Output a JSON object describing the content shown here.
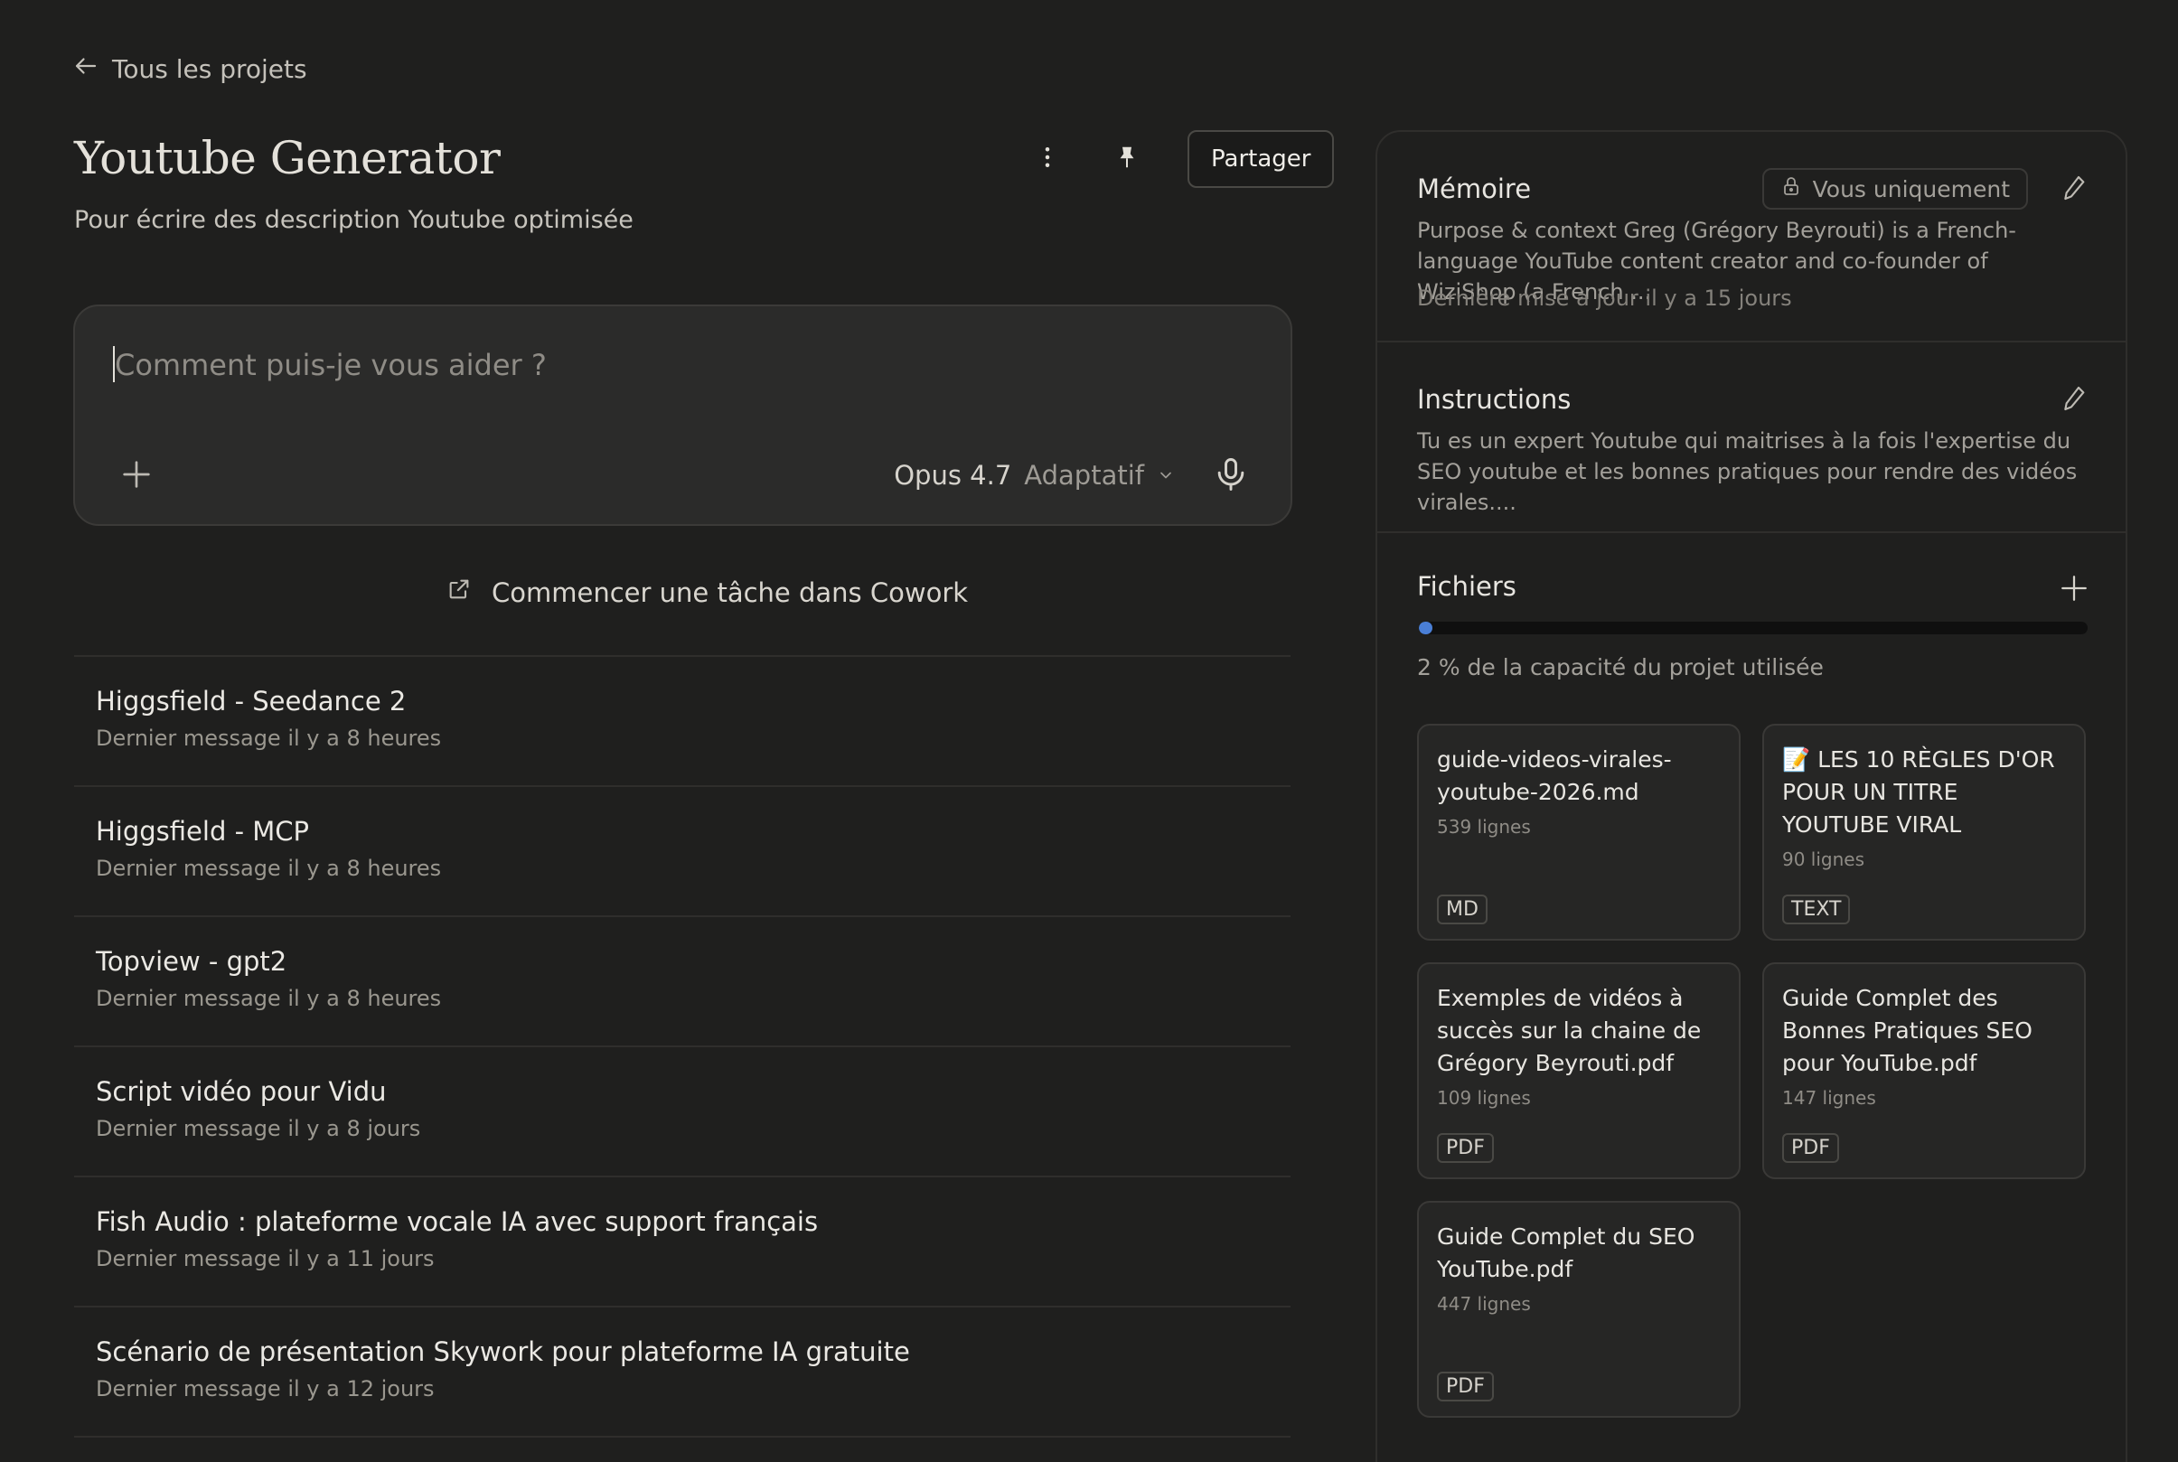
{
  "nav": {
    "back_label": "Tous les projets"
  },
  "project": {
    "title": "Youtube Generator",
    "subtitle": "Pour écrire des description Youtube optimisée",
    "share_label": "Partager"
  },
  "composer": {
    "placeholder": "Comment puis-je vous aider ?",
    "model_name": "Opus 4.7",
    "model_mode": "Adaptatif"
  },
  "cowork_label": "Commencer une tâche dans Cowork",
  "conversations": [
    {
      "title": "Higgsfield - Seedance 2",
      "subtitle": "Dernier message il y a 8 heures"
    },
    {
      "title": "Higgsfield - MCP",
      "subtitle": "Dernier message il y a 8 heures"
    },
    {
      "title": "Topview - gpt2",
      "subtitle": "Dernier message il y a 8 heures"
    },
    {
      "title": "Script vidéo pour Vidu",
      "subtitle": "Dernier message il y a 8 jours"
    },
    {
      "title": "Fish Audio : plateforme vocale IA avec support français",
      "subtitle": "Dernier message il y a 11 jours"
    },
    {
      "title": "Scénario de présentation Skywork pour plateforme IA gratuite",
      "subtitle": "Dernier message il y a 12 jours"
    }
  ],
  "memory": {
    "title": "Mémoire",
    "visibility": "Vous uniquement",
    "text": "Purpose & context Greg (Grégory Beyrouti) is a French-language YouTube content creator and co-founder of WiziShop (a French ...",
    "updated": "Dernière mise à jour il y a 15 jours"
  },
  "instructions": {
    "title": "Instructions",
    "text": "Tu es un expert Youtube qui maitrises à la fois l'expertise du SEO youtube et les bonnes pratiques pour rendre des vidéos virales...."
  },
  "files": {
    "title": "Fichiers",
    "capacity_text": "2 % de la capacité du projet utilisée",
    "capacity_percent": 2,
    "progress_color": "#4a7fd6",
    "items": [
      {
        "name": "guide-videos-virales-youtube-2026.md",
        "lines": "539 lignes",
        "type": "MD"
      },
      {
        "name": "📝 LES 10 RÈGLES D'OR POUR UN TITRE YOUTUBE VIRAL",
        "lines": "90 lignes",
        "type": "TEXT"
      },
      {
        "name": "Exemples de vidéos à succès sur la chaine de Grégory Beyrouti.pdf",
        "lines": "109 lignes",
        "type": "PDF"
      },
      {
        "name": "Guide Complet des Bonnes Pratiques SEO pour YouTube.pdf",
        "lines": "147 lignes",
        "type": "PDF"
      },
      {
        "name": "Guide Complet du SEO YouTube.pdf",
        "lines": "447 lignes",
        "type": "PDF"
      }
    ]
  }
}
